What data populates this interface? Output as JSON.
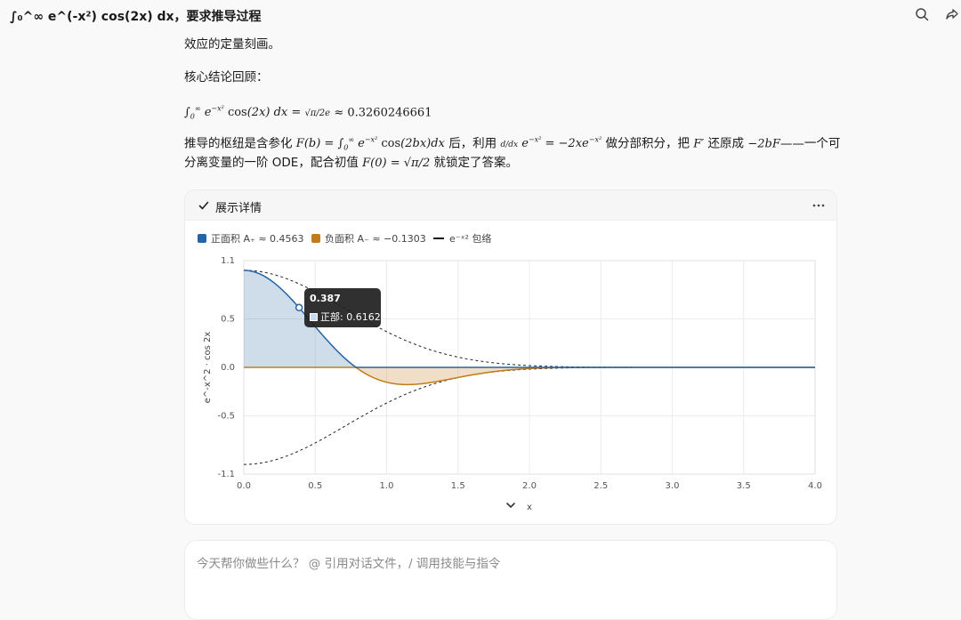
{
  "header": {
    "title": "∫₀^∞ e^(-x²) cos(2x) dx，要求推导过程",
    "search_icon": "search-icon",
    "share_icon": "share-icon"
  },
  "body": {
    "line_top": "效应的定量刻画。",
    "recap_heading": "核心结论回顾：",
    "result_lhs": "e",
    "result_rhs": "≈ 0.3260246661",
    "pivot_prefix": "推导的枢纽是含参化",
    "pivot_mid1": "后，利用",
    "pivot_mid2": "做分部积分，把",
    "pivot_mid3": "还原成",
    "pivot_tail": "——一个可",
    "line2_prefix": "分离变量的一阶 ODE，配合初值",
    "line2_tail": "就锁定了答案。"
  },
  "card": {
    "title": "展示详情",
    "check_icon": "check-icon",
    "more_icon": "more-icon",
    "collapse_icon": "chevron-down-icon"
  },
  "composer": {
    "placeholder": "今天帮你做些什么？ @ 引用对话文件，/ 调用技能与指令"
  },
  "chart_data": {
    "type": "area",
    "xlabel": "x",
    "ylabel": "e^-x^2 · cos 2x",
    "xlim": [
      0,
      4
    ],
    "ylim": [
      -1.1,
      1.1
    ],
    "x_ticks": [
      "0.0",
      "0.5",
      "1.0",
      "1.5",
      "2.0",
      "2.5",
      "3.0",
      "3.5",
      "4.0"
    ],
    "y_ticks": [
      "1.1",
      "0.5",
      "0.0",
      "-0.5",
      "-1.1"
    ],
    "grid": true,
    "legend_position": "top-left",
    "legend": [
      {
        "label": "正面积 A₊ ≈ 0.4563",
        "color": "#2563a6"
      },
      {
        "label": "负面积 A₋ ≈ −0.1303",
        "color": "#c27c1a"
      },
      {
        "label": "e⁻ˣ² 包络",
        "color": "#111111"
      }
    ],
    "series": [
      {
        "name": "正面积 A₊ ≈ 0.4563",
        "kind": "positive-part",
        "formula": "max(0, e^-x^2 cos 2x)"
      },
      {
        "name": "负面积 A₋ ≈ −0.1303",
        "kind": "negative-part",
        "formula": "min(0, e^-x^2 cos 2x)"
      },
      {
        "name": "e⁻ˣ² 包络",
        "kind": "envelope",
        "formula": "±e^-x^2"
      }
    ],
    "tooltip": {
      "x": 0.387,
      "title": "0.387",
      "label": "正部: 0.6162",
      "y": 0.6162
    }
  }
}
